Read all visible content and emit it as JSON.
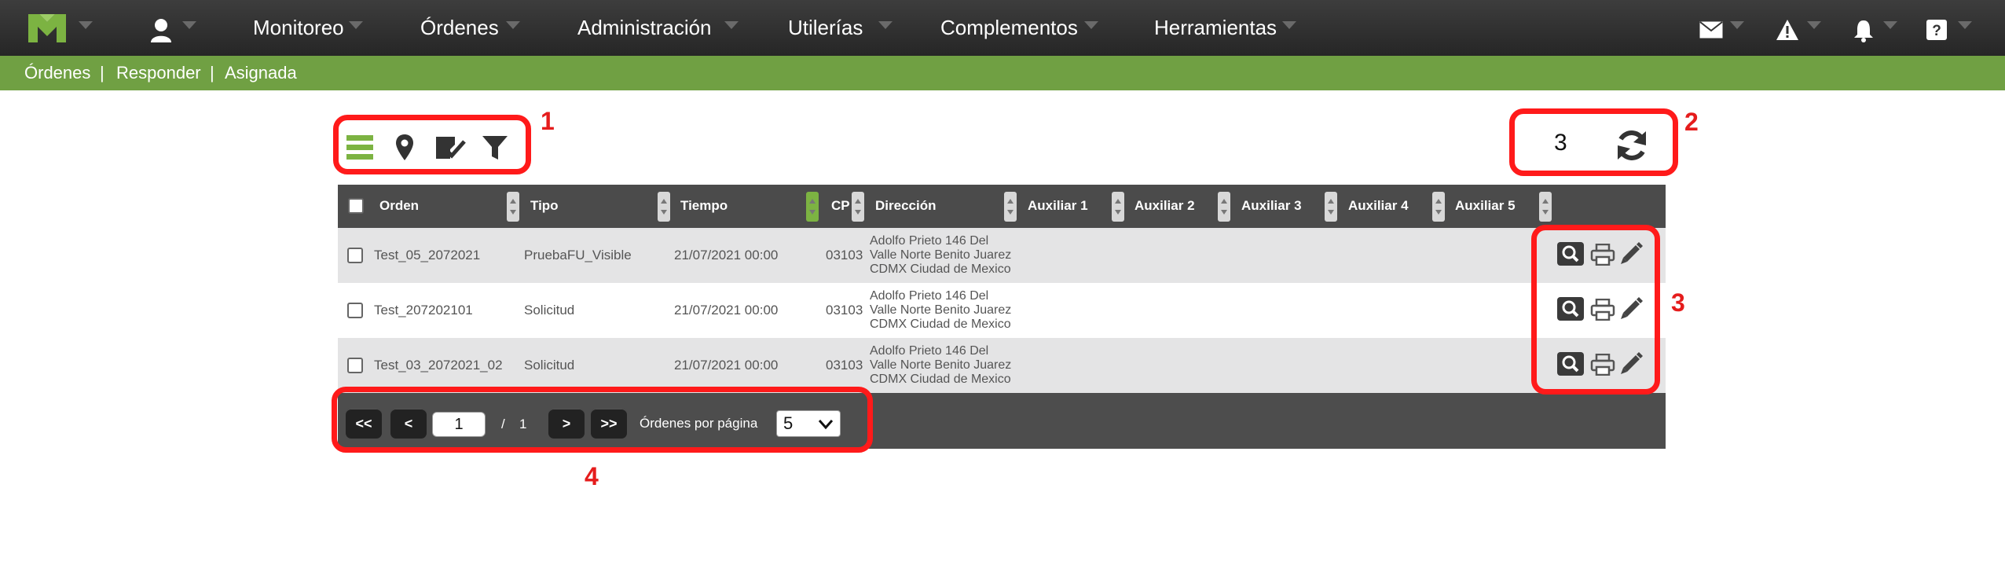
{
  "nav": {
    "items": [
      "Monitoreo",
      "Órdenes",
      "Administración",
      "Utilerías",
      "Complementos",
      "Herramientas"
    ]
  },
  "breadcrumb": [
    "Órdenes",
    "Responder",
    "Asignada"
  ],
  "breadcrumb_separator": "|",
  "toolbar": {
    "views": [
      "list-view-icon",
      "map-pin-icon",
      "assign-check-icon",
      "filter-icon"
    ],
    "count": "3",
    "refresh_icon": "refresh-icon"
  },
  "grid": {
    "columns": [
      "Orden",
      "Tipo",
      "Tiempo",
      "CP",
      "Dirección",
      "Auxiliar 1",
      "Auxiliar 2",
      "Auxiliar 3",
      "Auxiliar 4",
      "Auxiliar 5"
    ],
    "rows": [
      {
        "orden": "Test_05_2072021",
        "tipo": "PruebaFU_Visible",
        "tiempo": "21/07/2021 00:00",
        "cp": "03103",
        "direccion": [
          "Adolfo Prieto 146 Del",
          "Valle Norte Benito Juarez",
          "CDMX Ciudad de Mexico"
        ]
      },
      {
        "orden": "Test_207202101",
        "tipo": "Solicitud",
        "tiempo": "21/07/2021 00:00",
        "cp": "03103",
        "direccion": [
          "Adolfo Prieto 146 Del",
          "Valle Norte Benito Juarez",
          "CDMX Ciudad de Mexico"
        ]
      },
      {
        "orden": "Test_03_2072021_02",
        "tipo": "Solicitud",
        "tiempo": "21/07/2021 00:00",
        "cp": "03103",
        "direccion": [
          "Adolfo Prieto 146 Del",
          "Valle Norte Benito Juarez",
          "CDMX Ciudad de Mexico"
        ]
      }
    ],
    "row_actions": [
      "search-icon",
      "print-icon",
      "edit-pencil-icon"
    ]
  },
  "pager": {
    "first": "<<",
    "prev": "<",
    "page": "1",
    "of": "/",
    "total_pages": "1",
    "next": ">",
    "last": ">>",
    "per_page_label": "Órdenes por página",
    "per_page_value": "5"
  },
  "annotations": [
    "1",
    "2",
    "3",
    "4"
  ],
  "colors": {
    "topbar": "#2e2e2e",
    "breadcrumb_bar": "#70a043",
    "accent_green": "#7cb342",
    "callout_red": "#ff1a1a",
    "grid_header": "#4b4b4b"
  }
}
